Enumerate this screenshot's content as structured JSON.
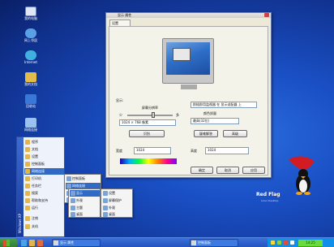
{
  "desktop_icons": [
    {
      "name": "my-computer-icon",
      "label": "我的电脑"
    },
    {
      "name": "network-icon",
      "label": "网上邻居"
    },
    {
      "name": "internet-icon",
      "label": "Internet"
    },
    {
      "name": "folder-icon",
      "label": "我的文档"
    },
    {
      "name": "flag-icon",
      "label": "回收站"
    },
    {
      "name": "network-places-icon",
      "label": "网络连接"
    }
  ],
  "window": {
    "title": "显示 属性",
    "tab_label": "设置",
    "label_display": "显示:",
    "label_resolution": "屏幕分辨率",
    "label_less": "少",
    "label_more": "多",
    "resolution_value": "1024 × 768 像素",
    "label_color": "颜色质量",
    "color_value": "最高(32位)",
    "button_identify": "识别",
    "button_troubleshoot": "疑难解答",
    "button_advanced": "高级",
    "adapter_value": "即插即用监视器 在 显示适配器 上",
    "label_left": "宽度",
    "label_right": "高度",
    "field_value": "1024",
    "button_ok": "确定",
    "button_cancel": "取消",
    "button_apply": "应用"
  },
  "start_menu": {
    "items": [
      {
        "label": "程序"
      },
      {
        "label": "文档"
      },
      {
        "label": "设置"
      },
      {
        "label": "控制面板"
      },
      {
        "label": "网络连接"
      },
      {
        "label": "打印机"
      },
      {
        "label": "任务栏"
      },
      {
        "label": "搜索"
      },
      {
        "label": "帮助和支持"
      },
      {
        "label": "运行"
      },
      {
        "label": "注销"
      },
      {
        "label": "关机"
      }
    ],
    "submenu1": [
      "控制面板",
      "网络连接",
      "打印机和传真",
      "任务栏"
    ],
    "submenu2": [
      "显示",
      "外观",
      "主题",
      "桌面"
    ],
    "submenu3": [
      "设置",
      "屏幕保护",
      "外观",
      "桌面"
    ],
    "strip_label": "Windows XP"
  },
  "taskbar": {
    "task1": "显示 属性",
    "task2": "控制面板",
    "clock": "14:25"
  },
  "logo": {
    "title": "Red Flag",
    "subtitle": "Linux Desktop"
  },
  "colors": {
    "desktop": "#1a4fc4",
    "taskbar": "#2453c0",
    "window_bg": "#ece9d8",
    "highlight": "#316ac5"
  }
}
